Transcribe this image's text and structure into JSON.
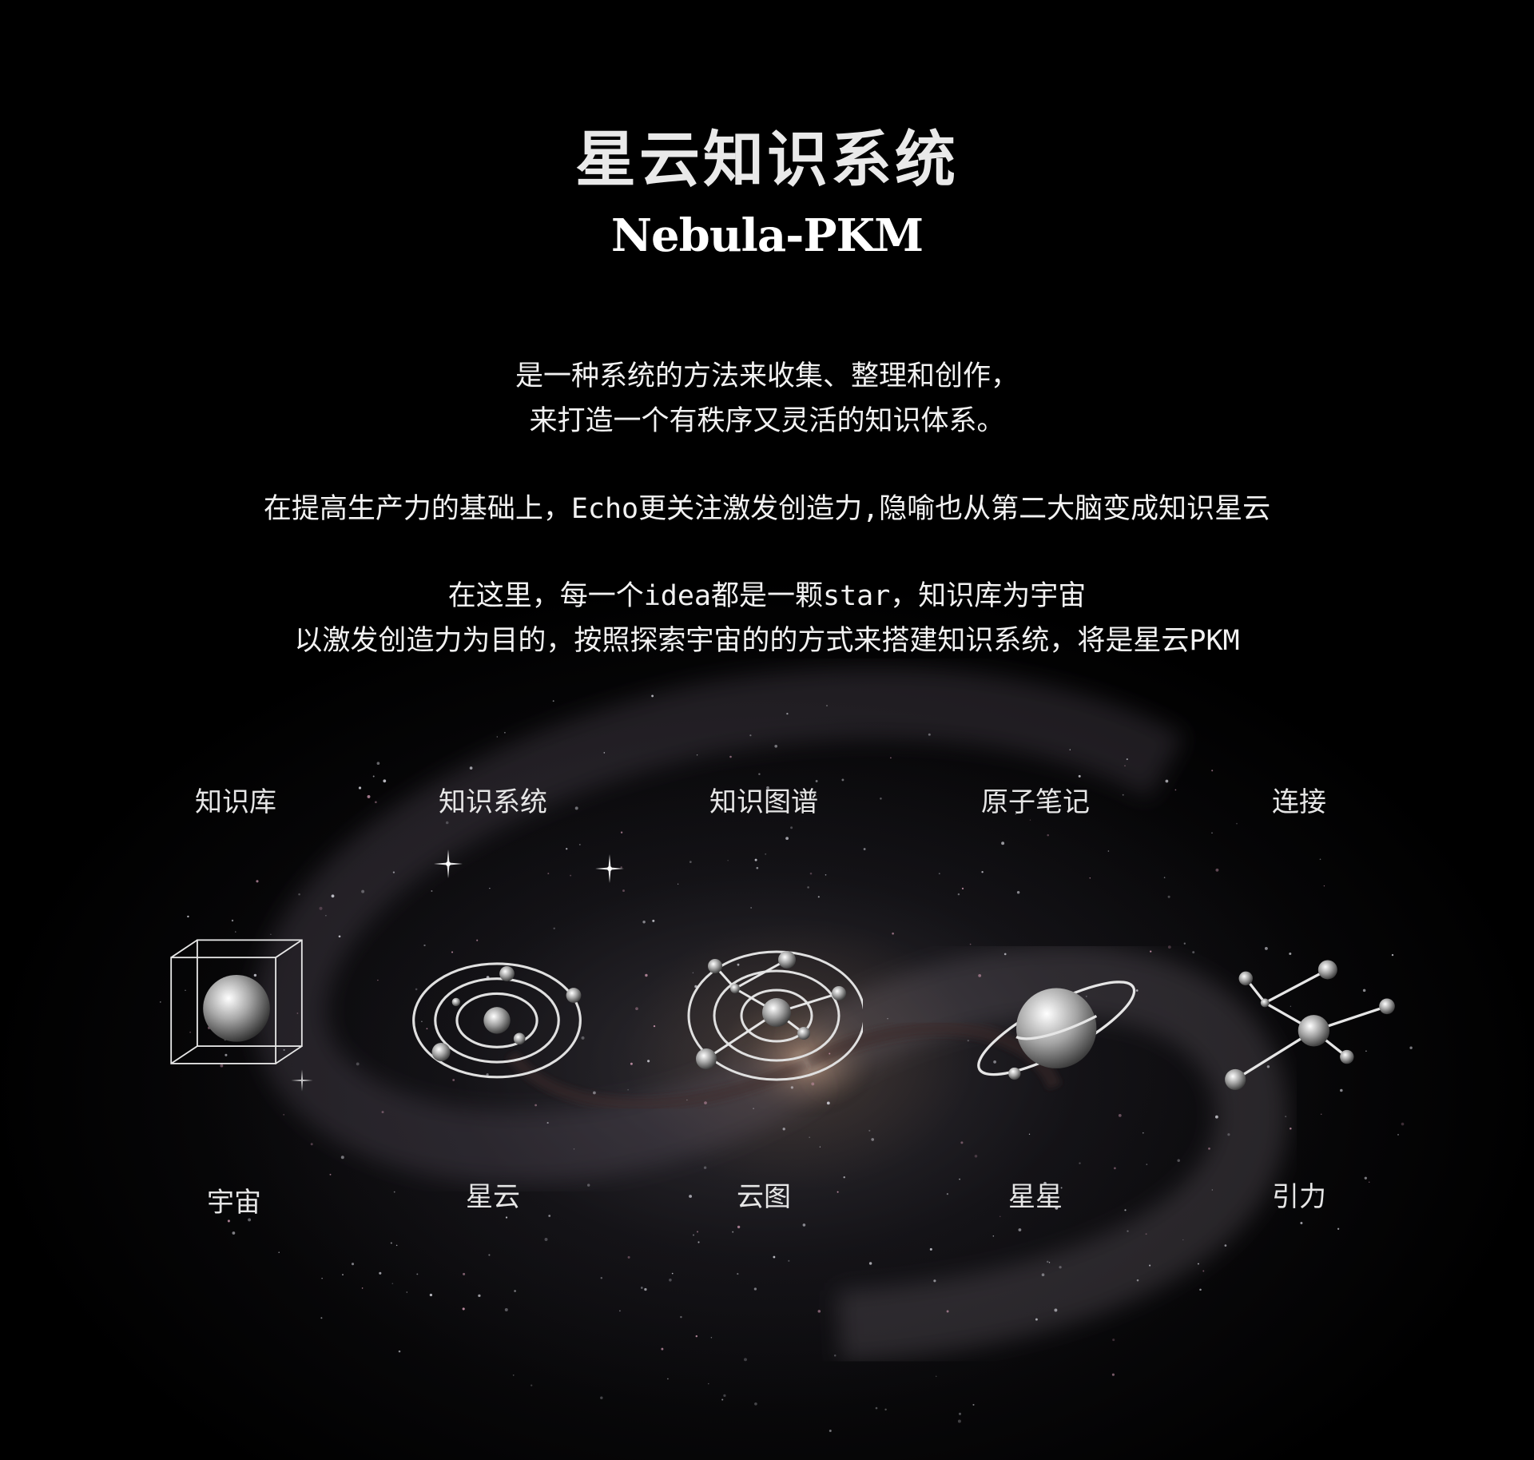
{
  "header": {
    "title": "星云知识系统",
    "subtitle": "Nebula-PKM"
  },
  "description": {
    "paragraph1": [
      "是一种系统的方法来收集、整理和创作，",
      "来打造一个有秩序又灵活的知识体系。"
    ],
    "paragraph2": "在提高生产力的基础上，Echo更关注激发创造力,隐喻也从第二大脑变成知识星云",
    "paragraph3": [
      "在这里，每一个idea都是一颗star，知识库为宇宙",
      "以激发创造力为目的，按照探索宇宙的的方式来搭建知识系统，将是星云PKM"
    ]
  },
  "concepts": [
    {
      "concept": "知识库",
      "metaphor": "宇宙",
      "icon": "cube-planet-icon"
    },
    {
      "concept": "知识系统",
      "metaphor": "星云",
      "icon": "orbit-system-icon"
    },
    {
      "concept": "知识图谱",
      "metaphor": "云图",
      "icon": "star-map-icon"
    },
    {
      "concept": "原子笔记",
      "metaphor": "星星",
      "icon": "ringed-planet-icon"
    },
    {
      "concept": "连接",
      "metaphor": "引力",
      "icon": "constellation-icon"
    }
  ],
  "colors": {
    "background": "#000000",
    "text": "#ffffff",
    "icon_stroke": "#e8e8e8"
  }
}
